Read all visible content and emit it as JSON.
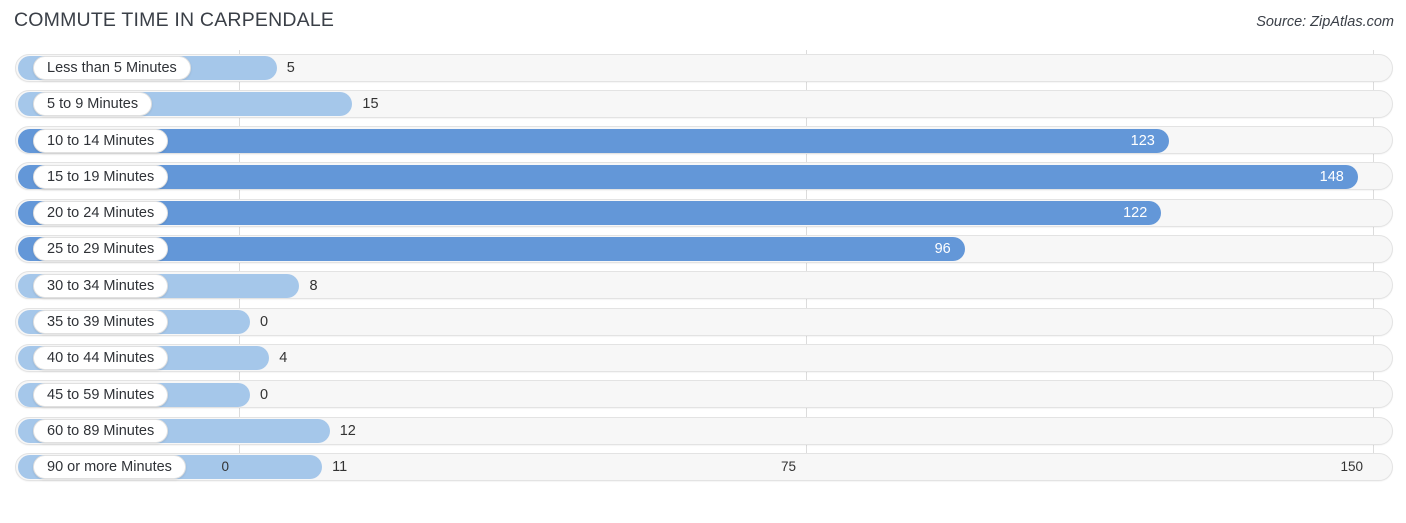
{
  "header": {
    "title": "COMMUTE TIME IN CARPENDALE",
    "source": "Source: ZipAtlas.com"
  },
  "colors": {
    "bar_light": "#a5c7ea",
    "bar_dark": "#6397d8",
    "track": "#f7f7f7",
    "gridline": "#dcdcdc",
    "text": "#333333"
  },
  "chart_data": {
    "type": "bar",
    "orientation": "horizontal",
    "title": "COMMUTE TIME IN CARPENDALE",
    "xlabel": "",
    "ylabel": "",
    "xlim": [
      0,
      150
    ],
    "xticks": [
      "0",
      "75",
      "150"
    ],
    "xtick_values": [
      0,
      75,
      150
    ],
    "grid": true,
    "legend": false,
    "categories": [
      "Less than 5 Minutes",
      "5 to 9 Minutes",
      "10 to 14 Minutes",
      "15 to 19 Minutes",
      "20 to 24 Minutes",
      "25 to 29 Minutes",
      "30 to 34 Minutes",
      "35 to 39 Minutes",
      "40 to 44 Minutes",
      "45 to 59 Minutes",
      "60 to 89 Minutes",
      "90 or more Minutes"
    ],
    "values": [
      5,
      15,
      123,
      148,
      122,
      96,
      8,
      0,
      4,
      0,
      12,
      11
    ],
    "value_labels": [
      "5",
      "15",
      "123",
      "148",
      "122",
      "96",
      "8",
      "0",
      "4",
      "0",
      "12",
      "11"
    ]
  }
}
